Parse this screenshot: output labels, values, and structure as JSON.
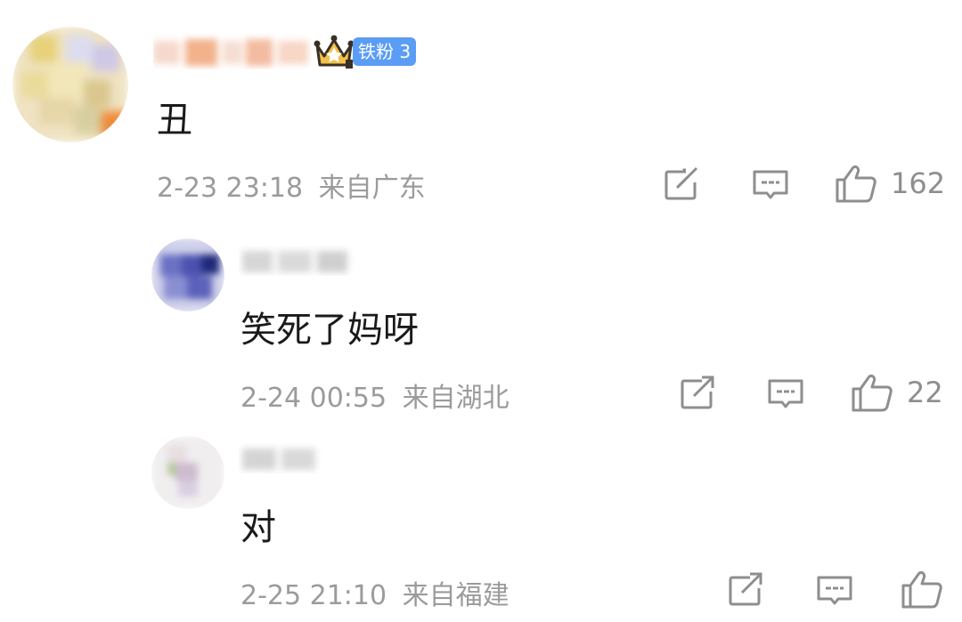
{
  "comments": [
    {
      "badge": "铁粉 3",
      "text": "丑",
      "time": "2-23 23:18",
      "location": "来自广东",
      "likes": "162"
    },
    {
      "text": "笑死了妈呀",
      "time": "2-24 00:55",
      "location": "来自湖北",
      "likes": "22"
    },
    {
      "text": "对",
      "time": "2-25 21:10",
      "location": "来自福建",
      "likes": ""
    }
  ],
  "icons": {
    "share": "share-icon",
    "reply": "comment-icon",
    "like": "thumb-up-icon",
    "crown": "crown-icon"
  },
  "colors": {
    "badge": "#5b9cf5",
    "meta_text": "#9b9b9b",
    "crown": "#e8b23a"
  }
}
